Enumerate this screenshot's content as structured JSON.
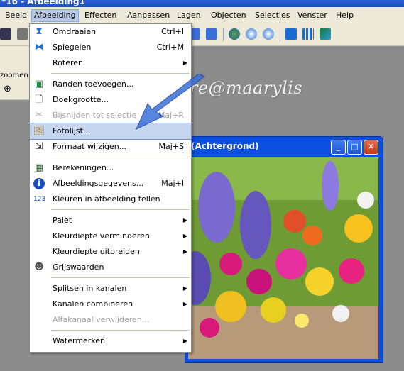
{
  "titlebar": {
    "title": "*16 - Afbeelding1"
  },
  "menubar": {
    "items": [
      "Beeld",
      "Afbeelding",
      "Effecten",
      "Aanpassen",
      "Lagen",
      "Objecten",
      "Selecties",
      "Venster",
      "Help"
    ]
  },
  "leftpanel": {
    "zoom_label": "zoomen:"
  },
  "watermark": "cre@maarylis",
  "image_window": {
    "title": "(Achtergrond)"
  },
  "dropdown": {
    "items": [
      {
        "label": "Omdraaien",
        "shortcut": "Ctrl+I",
        "icon": "flip-icon"
      },
      {
        "label": "Spiegelen",
        "shortcut": "Ctrl+M",
        "icon": "mirror-icon"
      },
      {
        "label": "Roteren",
        "shortcut": "",
        "icon": "",
        "submenu": true
      },
      {
        "label": "Randen toevoegen...",
        "shortcut": "",
        "icon": "add-borders-icon"
      },
      {
        "label": "Doekgrootte...",
        "shortcut": "",
        "icon": "canvas-size-icon"
      },
      {
        "label": "Bijsnijden tot selectie",
        "shortcut": "Maj+R",
        "icon": "crop-icon",
        "disabled": true
      },
      {
        "label": "Fotolijst...",
        "shortcut": "",
        "icon": "picture-frame-icon",
        "highlighted": true
      },
      {
        "label": "Formaat wijzigen...",
        "shortcut": "Maj+S",
        "icon": "resize-icon"
      },
      {
        "label": "Berekeningen...",
        "shortcut": "",
        "icon": "calculator-icon"
      },
      {
        "label": "Afbeeldingsgegevens...",
        "shortcut": "Maj+I",
        "icon": "info-icon"
      },
      {
        "label": "Kleuren in afbeelding tellen",
        "shortcut": "",
        "icon": "count-colors-icon"
      },
      {
        "label": "Palet",
        "shortcut": "",
        "icon": "",
        "submenu": true
      },
      {
        "label": "Kleurdiepte verminderen",
        "shortcut": "",
        "icon": "",
        "submenu": true
      },
      {
        "label": "Kleurdiepte uitbreiden",
        "shortcut": "",
        "icon": "",
        "submenu": true
      },
      {
        "label": "Grijswaarden",
        "shortcut": "",
        "icon": "grayscale-icon"
      },
      {
        "label": "Splitsen in kanalen",
        "shortcut": "",
        "icon": "",
        "submenu": true
      },
      {
        "label": "Kanalen combineren",
        "shortcut": "",
        "icon": "",
        "submenu": true
      },
      {
        "label": "Alfakanaal verwijderen...",
        "shortcut": "",
        "icon": "",
        "disabled": true
      },
      {
        "label": "Watermerken",
        "shortcut": "",
        "icon": "",
        "submenu": true
      }
    ]
  },
  "colors": {
    "menu_highlight": "#c6d6f0",
    "window_title": "#0a4fe0",
    "arrow": "#3a6fd8"
  }
}
